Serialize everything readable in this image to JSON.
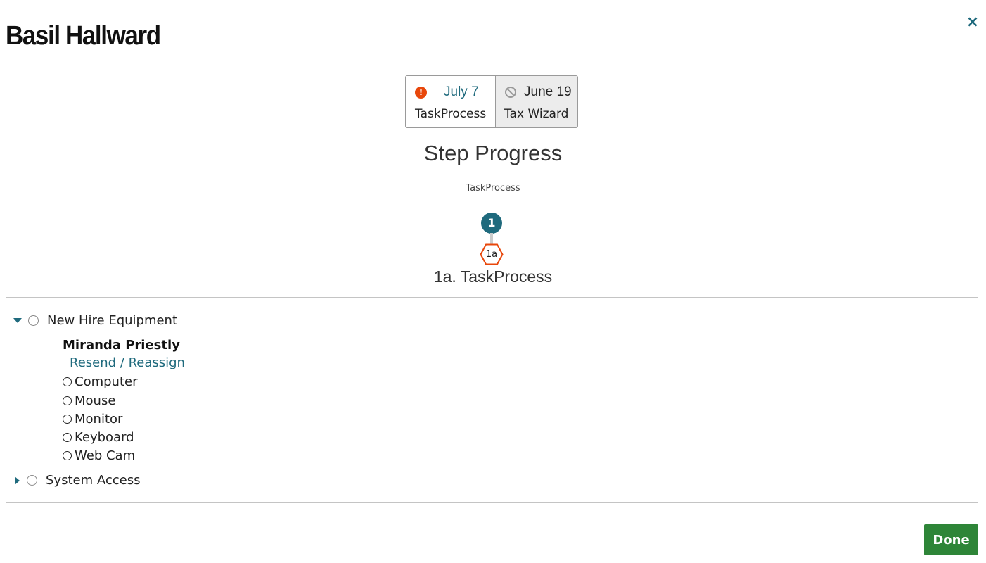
{
  "page": {
    "title": "Basil Hallward",
    "close_label": "×"
  },
  "tabs": [
    {
      "date": "July 7",
      "name": "TaskProcess",
      "icon": "alert-icon",
      "status_color": "#e8470b",
      "active": true
    },
    {
      "date": "June 19",
      "name": "Tax Wizard",
      "icon": "blocked-icon",
      "status_color": "#999999",
      "active": false
    }
  ],
  "progress": {
    "heading": "Step Progress",
    "subheading": "TaskProcess",
    "step_number": "1",
    "substep_label": "1a",
    "substep_title": "1a. TaskProcess"
  },
  "tasks": {
    "groups": [
      {
        "name": "New Hire Equipment",
        "expanded": true,
        "assignee": "Miranda Priestly",
        "action": "Resend / Reassign",
        "items": [
          "Computer",
          "Mouse",
          "Monitor",
          "Keyboard",
          "Web Cam"
        ]
      },
      {
        "name": "System Access",
        "expanded": false
      }
    ]
  },
  "footer": {
    "done_label": "Done"
  },
  "colors": {
    "accent": "#1f6a7d",
    "alert": "#e8470b",
    "done": "#2e8538"
  }
}
